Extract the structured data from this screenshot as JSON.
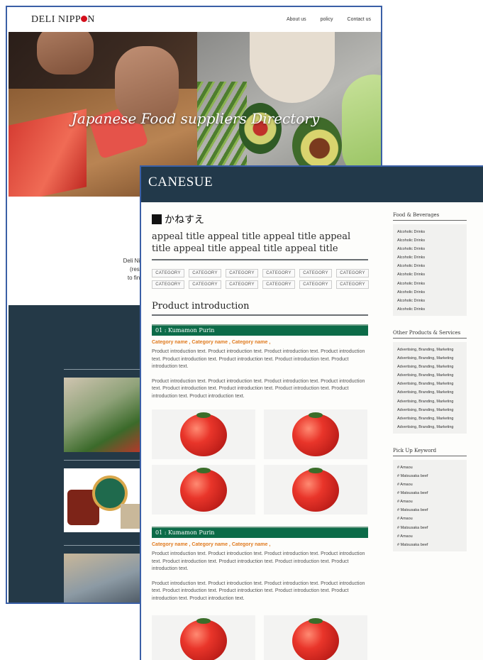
{
  "back": {
    "logo": {
      "part1": "DELI NIPP",
      "part2": "N"
    },
    "nav": [
      "About us",
      "policy",
      "Contact us"
    ],
    "hero_title": "Japanese Food suppliers Directory",
    "intro_lines": [
      "Deli Nippon",
      "(restaura",
      "to find foo"
    ],
    "colors": {
      "dark_section": "#243947",
      "frame": "#3a5fa6"
    }
  },
  "front": {
    "brand": "CANESUE",
    "kanji_logo": "かねすえ",
    "appeal_title": "appeal title appeal title appeal title appeal title appeal title appeal title appeal title",
    "categories": [
      "CATEGORY",
      "CATEGORY",
      "CATEGORY",
      "CATEGORY",
      "CATEGORY",
      "CATEGORY",
      "CATEGORY",
      "CATEGORY",
      "CATEGORY",
      "CATEGORY",
      "CATEGORY",
      "CATEGORY"
    ],
    "section_title": "Product introduction",
    "products": [
      {
        "name": "01 : Kumamon Purin",
        "categories": "Category name , Category name , Category name ,",
        "text1": "Product introduction text. Product introduction text. Product introduction text. Product introduction text. Product introduction text. Product introduction text. Product introduction text. Product introduction text.",
        "text2": "Product introduction text. Product introduction text. Product introduction text. Product introduction text. Product introduction text. Product introduction text. Product introduction text. Product introduction text. Product introduction text."
      },
      {
        "name": "01 : Kumamon Purin",
        "categories": "Category name , Category name , Category name ,",
        "text1": "Product introduction text. Product introduction text. Product introduction text. Product introduction text. Product introduction text. Product introduction text. Product introduction text. Product introduction text.",
        "text2": "Product introduction text. Product introduction text. Product introduction text. Product introduction text. Product introduction text. Product introduction text. Product introduction text. Product introduction text. Product introduction text."
      }
    ],
    "sidebar": {
      "food_title": "Food & Beverages",
      "food_items": [
        "Alcoholic Drinks",
        "Alcoholic Drinks",
        "Alcoholic Drinks",
        "Alcoholic Drinks",
        "Alcoholic Drinks",
        "Alcoholic Drinks",
        "Alcoholic Drinks",
        "Alcoholic Drinks",
        "Alcoholic Drinks",
        "Alcoholic Drinks"
      ],
      "other_title": "Other Products & Services",
      "other_items": [
        "Advertising, Branding, Marketing",
        "Advertising, Branding, Marketing",
        "Advertising, Branding, Marketing",
        "Advertising, Branding, Marketing",
        "Advertising, Branding, Marketing",
        "Advertising, Branding, Marketing",
        "Advertising, Branding, Marketing",
        "Advertising, Branding, Marketing",
        "Advertising, Branding, Marketing",
        "Advertising, Branding, Marketing"
      ],
      "pickup_title": "Pick Up Keyword",
      "pickup_items": [
        "# Amaou",
        "# Matsusaka beef",
        "# Amaou",
        "# Matsusaka beef",
        "# Amaou",
        "# Matsusaka beef",
        "# Amaou",
        "# Matsusaka beef",
        "# Amaou",
        "# Matsusaka beef"
      ]
    },
    "colors": {
      "banner": "#22394a",
      "product_bar": "#0c6b48",
      "category_accent": "#e07a1e"
    }
  }
}
